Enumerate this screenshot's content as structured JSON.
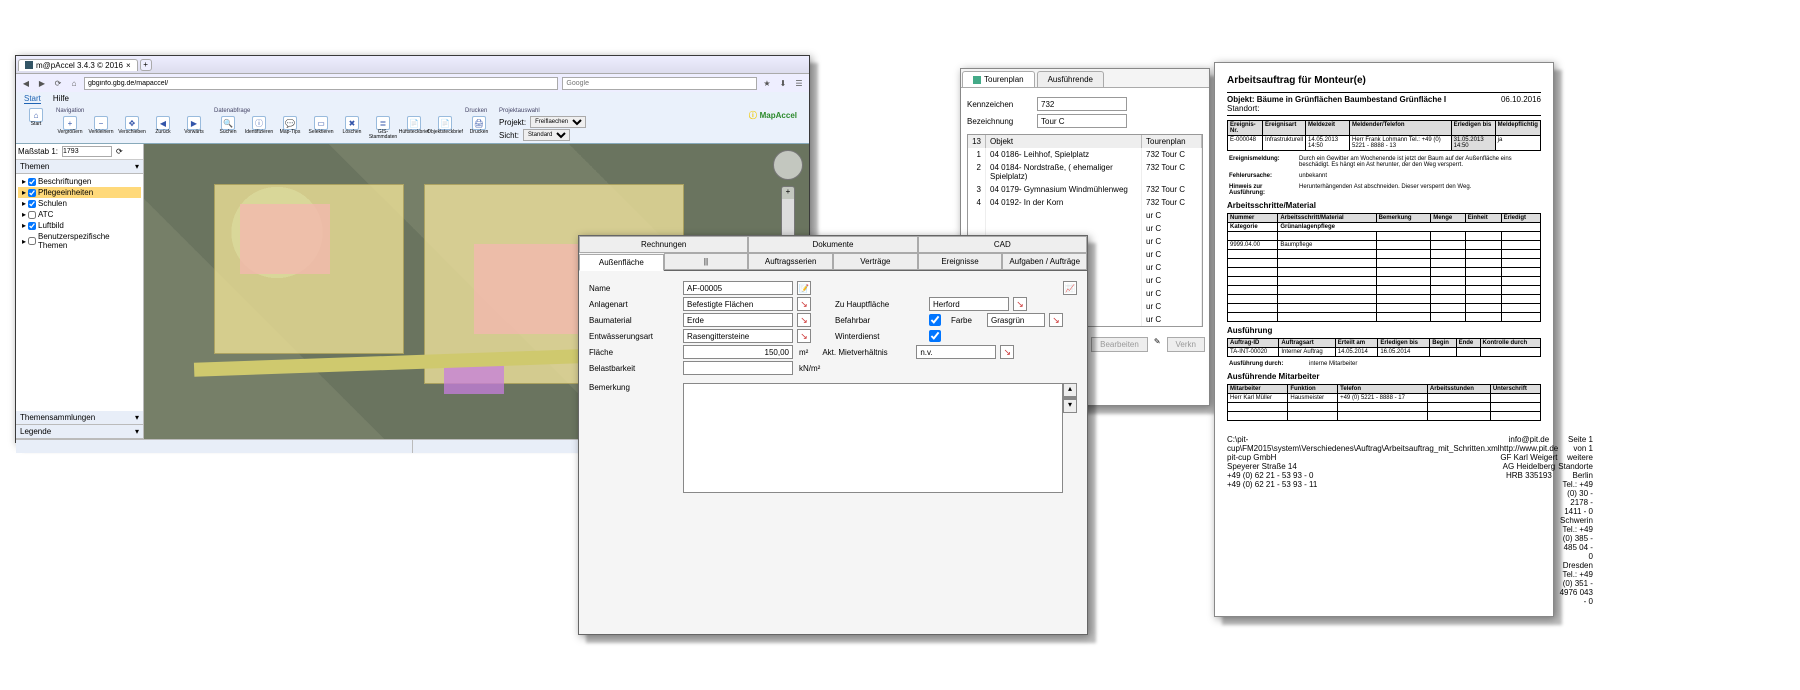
{
  "browser": {
    "tab_title": "m@pAccel 3.4.3 © 2016",
    "url": "gbginfo.gbg.de/mapaccel/",
    "search_placeholder": "Google",
    "menu": [
      "Start",
      "Hilfe"
    ],
    "group_nav_title": "Navigation",
    "group_data_title": "Datenabfrage",
    "group_print_title": "Drucken",
    "group_proj_title": "Projektauswahl",
    "icons": {
      "start": "Start",
      "zoomin": "Vergrößern",
      "zoomout": "Verkleinern",
      "pan": "Verschieben",
      "back": "Zurück",
      "fwd": "Vorwärts",
      "search": "Suchen",
      "ident": "Identifizieren",
      "maptips": "Map-Tips",
      "select": "Selektieren",
      "del": "Löschen",
      "gis": "GIS-Stammdaten",
      "post": "Hüftsteckbrief",
      "obj": "Objektsteckbrief",
      "print": "Drucken"
    },
    "projekt_label": "Projekt:",
    "projekt_value": "Freiflaechen",
    "sicht_label": "Sicht:",
    "sicht_value": "Standard",
    "logo": "MapAccel",
    "scale_label": "Maßstab 1:",
    "scale_value": "1793",
    "panel_themen": "Themen",
    "tree": [
      {
        "label": "Beschriftungen",
        "checked": true
      },
      {
        "label": "Pflegeeinheiten",
        "checked": true,
        "selected": true
      },
      {
        "label": "Schulen",
        "checked": true
      },
      {
        "label": "ATC",
        "checked": false
      },
      {
        "label": "Luftbild",
        "checked": true
      },
      {
        "label": "Benutzerspezifische Themen",
        "checked": false
      }
    ],
    "panel_samm": "Themensammlungen",
    "panel_leg": "Legende"
  },
  "tour": {
    "tabs": [
      "Tourenplan",
      "Ausführende"
    ],
    "kennzeichen_label": "Kennzeichen",
    "kennzeichen": "732",
    "bez_label": "Bezeichnung",
    "bez": "Tour C",
    "columns": [
      "13",
      "Objekt",
      "Tourenplan"
    ],
    "rows": [
      {
        "n": "1",
        "o": "04 0186- Leihhof, Spielplatz",
        "t": "732 Tour C"
      },
      {
        "n": "2",
        "o": "04 0184- Nordstraße, ( ehemaliger Spielplatz)",
        "t": "732 Tour C"
      },
      {
        "n": "3",
        "o": "04 0179- Gymnasium Windmühlenweg",
        "t": "732 Tour C"
      },
      {
        "n": "4",
        "o": "04 0192- In der Korn",
        "t": "732 Tour C"
      },
      {
        "n": "",
        "o": "",
        "t": "ur C"
      },
      {
        "n": "",
        "o": "",
        "t": "ur C"
      },
      {
        "n": "",
        "o": "",
        "t": "ur C"
      },
      {
        "n": "",
        "o": "",
        "t": "ur C"
      },
      {
        "n": "",
        "o": "",
        "t": "ur C"
      },
      {
        "n": "",
        "o": "",
        "t": "ur C"
      },
      {
        "n": "",
        "o": "",
        "t": "ur C"
      },
      {
        "n": "",
        "o": "",
        "t": "ur C"
      },
      {
        "n": "",
        "o": "",
        "t": "ur C"
      }
    ],
    "btn_edit": "Bearbeiten",
    "btn_link": "Verkn"
  },
  "af": {
    "tabs1": [
      "Rechnungen",
      "Dokumente",
      "CAD"
    ],
    "tabs2": [
      "Außenfläche",
      "||",
      "Auftragsserien",
      "Verträge",
      "Ereignisse",
      "Aufgaben / Aufträge"
    ],
    "name_label": "Name",
    "name": "AF-00005",
    "anlagenart_label": "Anlagenart",
    "anlagenart": "Befestigte Flächen",
    "baumaterial_label": "Baumaterial",
    "baumaterial": "Erde",
    "entw_label": "Entwässerungsart",
    "entw": "Rasengittersteine",
    "flaeche_label": "Fläche",
    "flaeche": "150,00",
    "flaeche_unit": "m²",
    "belast_label": "Belastbarkeit",
    "belast": "",
    "belast_unit": "kN/m²",
    "haupt_label": "Zu Hauptfläche",
    "haupt": "Herford",
    "befahr_label": "Befahrbar",
    "befahr": true,
    "farbe_label": "Farbe",
    "farbe": "Grasgrün",
    "winter_label": "Winterdienst",
    "winter": true,
    "miet_label": "Akt. Mietverhältnis",
    "miet": "n.v.",
    "bemerkung_label": "Bemerkung",
    "bemerkung": ""
  },
  "doc": {
    "title": "Arbeitsauftrag für Monteur(e)",
    "obj_label": "Objekt: Bäume in Grünflächen Baumbestand Grünfläche I",
    "standort_label": "Standort:",
    "date": "06.10.2016",
    "hdr": [
      "Ereignis-Nr.",
      "Ereignisart",
      "Meldezeit",
      "Meldender/Telefon",
      "Erledigen bis",
      "Meldepflichtig"
    ],
    "hdr_vals": [
      "E-000048",
      "Infrastrukturell",
      "14.05.2013 14:50",
      "Herr Frank Lohmann\nTel.: +49 (0) 5221 - 8888 - 13",
      "31.05.2013 14:50",
      "ja"
    ],
    "meldung_label": "Ereignismeldung:",
    "meldung": "Durch ein Gewitter am Wochenende ist jetzt der Baum auf der Außenfläche eins beschädigt. Es hängt ein Ast herunter, der den Weg versperrt.",
    "fehler_label": "Fehlerursache:",
    "fehler": "unbekannt",
    "hinweis_label": "Hinweis zur Ausführung:",
    "hinweis": "Herunterhängenden Ast abschneiden. Dieser versperrt den Weg.",
    "as_title": "Arbeitsschritte/Material",
    "as_hdr": [
      "Nummer",
      "Arbeitsschritt/Material",
      "Bemerkung",
      "Menge",
      "Einheit",
      "Erledigt"
    ],
    "kat_label": "Kategorie",
    "kat": "Grünanlagenpflege",
    "as_row": [
      "9999.04.00",
      "Baumpflege",
      "",
      "",
      "",
      ""
    ],
    "ausf_title": "Ausführung",
    "ausf_hdr": [
      "Auftrag-ID",
      "Auftragsart",
      "Erteilt am",
      "Erledigen bis",
      "Begin",
      "Ende",
      "Kontrolle durch"
    ],
    "ausf_row": [
      "TA-INT-00020",
      "Interner Auftrag",
      "14.05.2014",
      "16.05.2014",
      "",
      "",
      ""
    ],
    "ausf_durch_label": "Ausführung durch:",
    "ausf_durch": "interne Mitarbeiter",
    "mit_title": "Ausführende Mitarbeiter",
    "mit_hdr": [
      "Mitarbeiter",
      "Funktion",
      "Telefon",
      "Arbeitsstunden",
      "Unterschrift"
    ],
    "mit_row": [
      "Herr Karl Müller",
      "Hausmeister",
      "+49 (0) 5221 - 8888 - 17",
      "",
      ""
    ],
    "foot_left": "C:\\pit-cup\\FM2015\\system\\Verschiedenes\\Auftrag\\Arbeitsauftrag_mit_Schritten.xml\npit-cup GmbH\nSpeyerer Straße 14\n+49 (0) 62 21 - 53 93 - 0\n+49 (0) 62 21 - 53 93 - 11",
    "foot_mid": "info@pit.de\nhttp://www.pit.de\nGF Karl Weigert\nAG Heidelberg HRB 335193",
    "foot_right": "Seite 1 von 1\nweitere Standorte\nBerlin Tel.: +49 (0) 30 - 2178 - 1411 - 0\nSchwerin Tel.: +49 (0) 385 - 485 04 - 0\nDresden Tel.: +49 (0) 351 - 4976 043 - 0"
  }
}
